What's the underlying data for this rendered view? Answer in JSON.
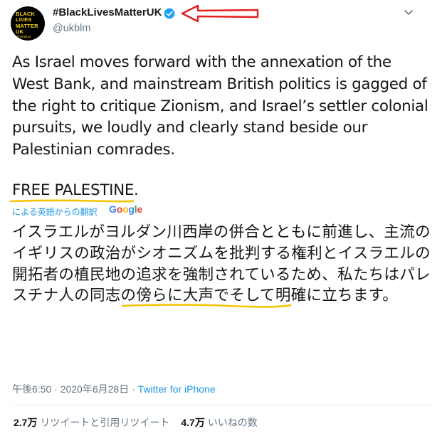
{
  "profile": {
    "avatar_lines": [
      "BLACK",
      "LIVES",
      "MATTER",
      "UK"
    ],
    "avatar_handle": "@UKBLM",
    "display_name": "#BlackLivesMatterUK",
    "handle": "@ukblm",
    "verified_icon": "verified-badge-icon"
  },
  "tweet": {
    "text": "As Israel moves forward with the annexation of the\nWest Bank, and mainstream British politics is gagged of\nthe right to critique Zionism, and Israel’s settler colonial\npursuits, we loudly and clearly stand beside our\nPalestinian comrades.",
    "free_palestine": "FREE PALESTINE.",
    "translate_label": "による英語からの翻訳",
    "google_letters": [
      "G",
      "o",
      "o",
      "g",
      "l",
      "e"
    ],
    "translation": "イスラエルがヨルダン川西岸の併合とともに前進し、主流のイギリスの政治がシオニズムを批判する権利とイスラエルの開拓者の植民地の追求を強制されているため、私たちはパレスチナ人の同志の傍らに大声でそして明確に立ちます。"
  },
  "meta": {
    "time": "午後6:50",
    "separator": "·",
    "date": "2020年6月28日",
    "via": "Twitter for iPhone"
  },
  "stats": {
    "retweets_count": "2.7万",
    "retweets_label": "リツイートと引用リツイート",
    "likes_count": "4.7万",
    "likes_label": "いいねの数"
  },
  "colors": {
    "link_blue": "#1b95e0",
    "annotation_red": "#e02020",
    "underline_yellow": "#f5c400",
    "google": [
      "#4285f4",
      "#ea4335",
      "#fbbc05",
      "#4285f4",
      "#34a853",
      "#ea4335"
    ]
  },
  "icons": [
    "caret-down-icon",
    "red-arrow-annotation-icon"
  ]
}
